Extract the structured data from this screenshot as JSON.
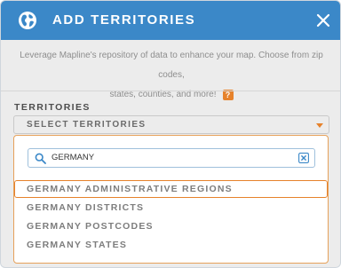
{
  "header": {
    "title": "ADD TERRITORIES",
    "icon": "globe-icon",
    "close_icon": "close-icon",
    "bg_color": "#3b88c8"
  },
  "description": {
    "line1": "Leverage Mapline's repository of data to enhance your map. Choose from zip codes,",
    "line2": "states, counties, and more!",
    "help_label": "?"
  },
  "territories": {
    "label": "TERRITORIES",
    "select_label": "SELECT TERRITORIES",
    "caret_icon": "caret-down-icon",
    "accent_color": "#e6822b"
  },
  "search": {
    "value": "GERMANY",
    "icon": "search-icon",
    "clear_icon": "clear-icon"
  },
  "options": [
    {
      "label": "GERMANY ADMINISTRATIVE REGIONS",
      "highlighted": true
    },
    {
      "label": "GERMANY DISTRICTS",
      "highlighted": false
    },
    {
      "label": "GERMANY POSTCODES",
      "highlighted": false
    },
    {
      "label": "GERMANY STATES",
      "highlighted": false
    }
  ]
}
